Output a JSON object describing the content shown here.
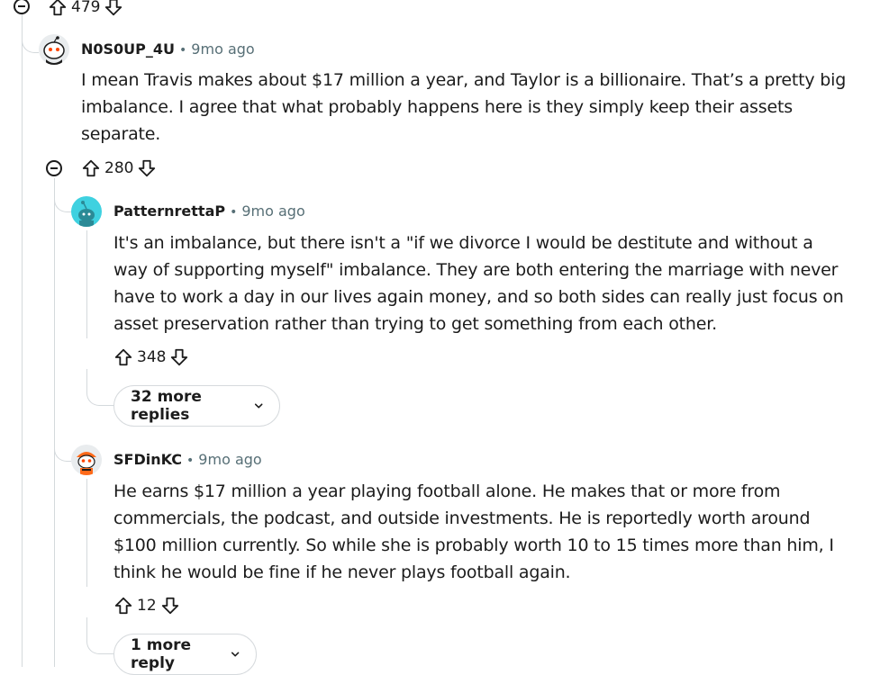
{
  "top_votes": {
    "score": "479"
  },
  "comments": [
    {
      "author": "N0S0UP_4U",
      "time": "9mo ago",
      "separator": "•",
      "lines": [
        "I mean Travis makes about $17 million a year, and Taylor is a billionaire. That’s a pretty big",
        "imbalance. I agree that what probably happens here is they simply keep their assets",
        "separate."
      ],
      "score": "280"
    },
    {
      "author": "PatternrettaP",
      "time": "9mo ago",
      "separator": "•",
      "lines": [
        "It's an imbalance, but there isn't a \"if we divorce I would be destitute and without a",
        "way of supporting myself\" imbalance. They are both entering the marriage with never",
        "have to work a day in our lives again money, and so both sides can really just focus on",
        "asset preservation rather than trying to get something from each other."
      ],
      "score": "348",
      "more_replies": "32 more replies"
    },
    {
      "author": "SFDinKC",
      "time": "9mo ago",
      "separator": "•",
      "lines": [
        "He earns $17 million a year playing football alone. He makes that or more from",
        "commercials, the podcast, and outside investments. He is reportedly worth around",
        "$100 million currently. So while she is probably worth 10 to 15 times more than him, I",
        "think he would be fine if he never plays football again."
      ],
      "score": "12",
      "more_replies": "1 more reply"
    }
  ],
  "icons": {
    "upvote": "upvote-icon",
    "downvote": "downvote-icon",
    "collapse": "collapse-icon",
    "chevron": "chevron-down-icon"
  }
}
